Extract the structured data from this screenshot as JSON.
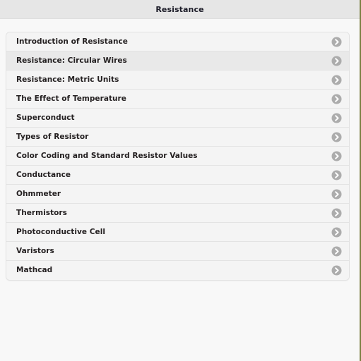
{
  "header": {
    "title": "Resistance"
  },
  "colors": {
    "header_bg": "#e6e6e6",
    "page_bg": "#f8f8f8",
    "row_bg": "#f4f4f4",
    "row_selected_bg": "#e9e9e9",
    "row_divider": "#e3e3e3",
    "text": "#242021",
    "title_text": "#1c1c28",
    "chevron_circle": "#acacac",
    "chevron_arrow": "#ffffff",
    "right_edge": "#7c8044"
  },
  "list": {
    "chevron_icon_name": "chevron-right-circle-icon",
    "items": [
      {
        "label": "Introduction of Resistance",
        "selected": false
      },
      {
        "label": "Resistance: Circular Wires",
        "selected": true
      },
      {
        "label": "Resistance: Metric Units",
        "selected": false
      },
      {
        "label": "The Effect of Temperature",
        "selected": false
      },
      {
        "label": "Superconduct",
        "selected": false
      },
      {
        "label": "Types of Resistor",
        "selected": false
      },
      {
        "label": "Color Coding and Standard Resistor Values",
        "selected": false
      },
      {
        "label": "Conductance",
        "selected": false
      },
      {
        "label": "Ohmmeter",
        "selected": false
      },
      {
        "label": "Thermistors",
        "selected": false
      },
      {
        "label": "Photoconductive Cell",
        "selected": false
      },
      {
        "label": "Varistors",
        "selected": false
      },
      {
        "label": "Mathcad",
        "selected": false
      }
    ]
  }
}
